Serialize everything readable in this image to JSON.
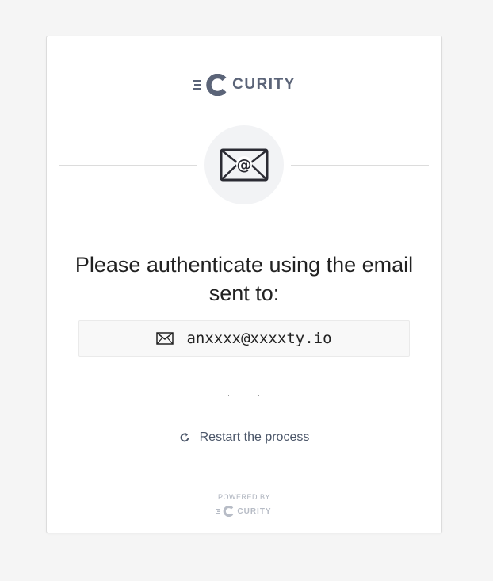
{
  "brand": {
    "name": "CURITY",
    "color": "#5b6478",
    "logo_icon": "curity-logo-icon"
  },
  "hero_icon": "envelope-at-icon",
  "heading": "Please authenticate using the email sent to:",
  "email": {
    "icon": "mail-icon",
    "value": "anxxxx@xxxxty.io"
  },
  "restart": {
    "icon": "refresh-icon",
    "label": "Restart the process"
  },
  "footer": {
    "powered_by": "POWERED BY",
    "brand": "CURITY",
    "color": "#b7bcc6"
  }
}
